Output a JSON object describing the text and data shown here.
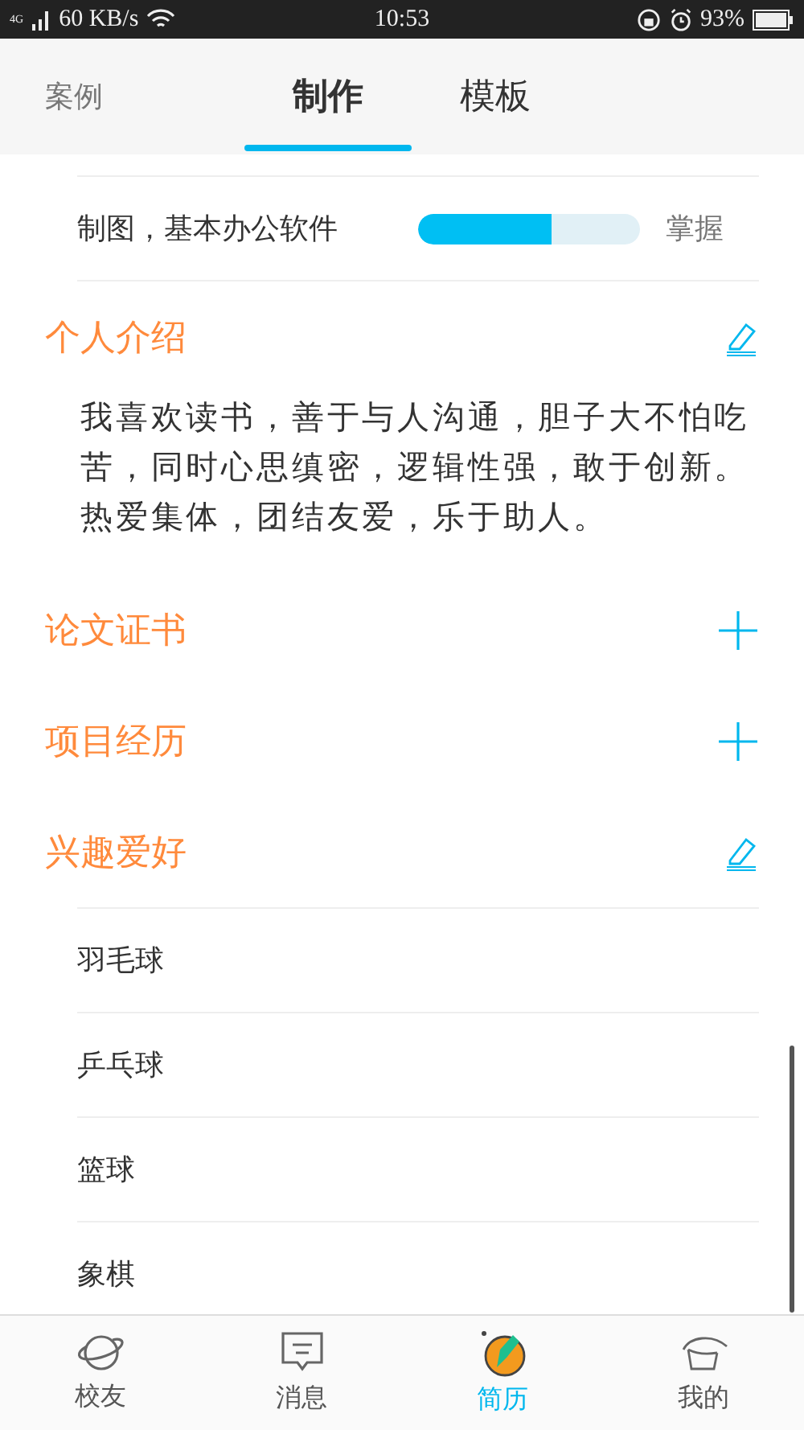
{
  "status_bar": {
    "network": "4G",
    "speed": "60 KB/s",
    "time": "10:53",
    "battery": "93%"
  },
  "tabs": [
    {
      "label": "案例",
      "kind": "link",
      "selected": false
    },
    {
      "label": "制作",
      "kind": "tab",
      "selected": true
    },
    {
      "label": "模板",
      "kind": "tab",
      "selected": false
    }
  ],
  "skills": [
    {
      "name": "制图，基本办公软件",
      "level": 0.6,
      "reading": "掌握"
    }
  ],
  "sections": [
    {
      "title": "个人介绍",
      "kind": "edit",
      "paragraph": "我喜欢读书，善于与人沟通，胆子大不怕吃苦，同时心思缜密，逻辑性强，敢于创新。热爱集体，团结友爱，乐于助人。"
    },
    {
      "title": "论文证书",
      "kind": "add"
    },
    {
      "title": "项目经历",
      "kind": "add"
    },
    {
      "title": "兴趣爱好",
      "kind": "edit",
      "items": [
        "羽毛球",
        "乒乓球",
        "篮球",
        "象棋"
      ]
    }
  ],
  "bottom_nav": [
    {
      "label": "校友",
      "kind": "planet",
      "selected": false
    },
    {
      "label": "消息",
      "kind": "message",
      "selected": false
    },
    {
      "label": "简历",
      "kind": "resume",
      "selected": true
    },
    {
      "label": "我的",
      "kind": "hat",
      "selected": false
    }
  ]
}
